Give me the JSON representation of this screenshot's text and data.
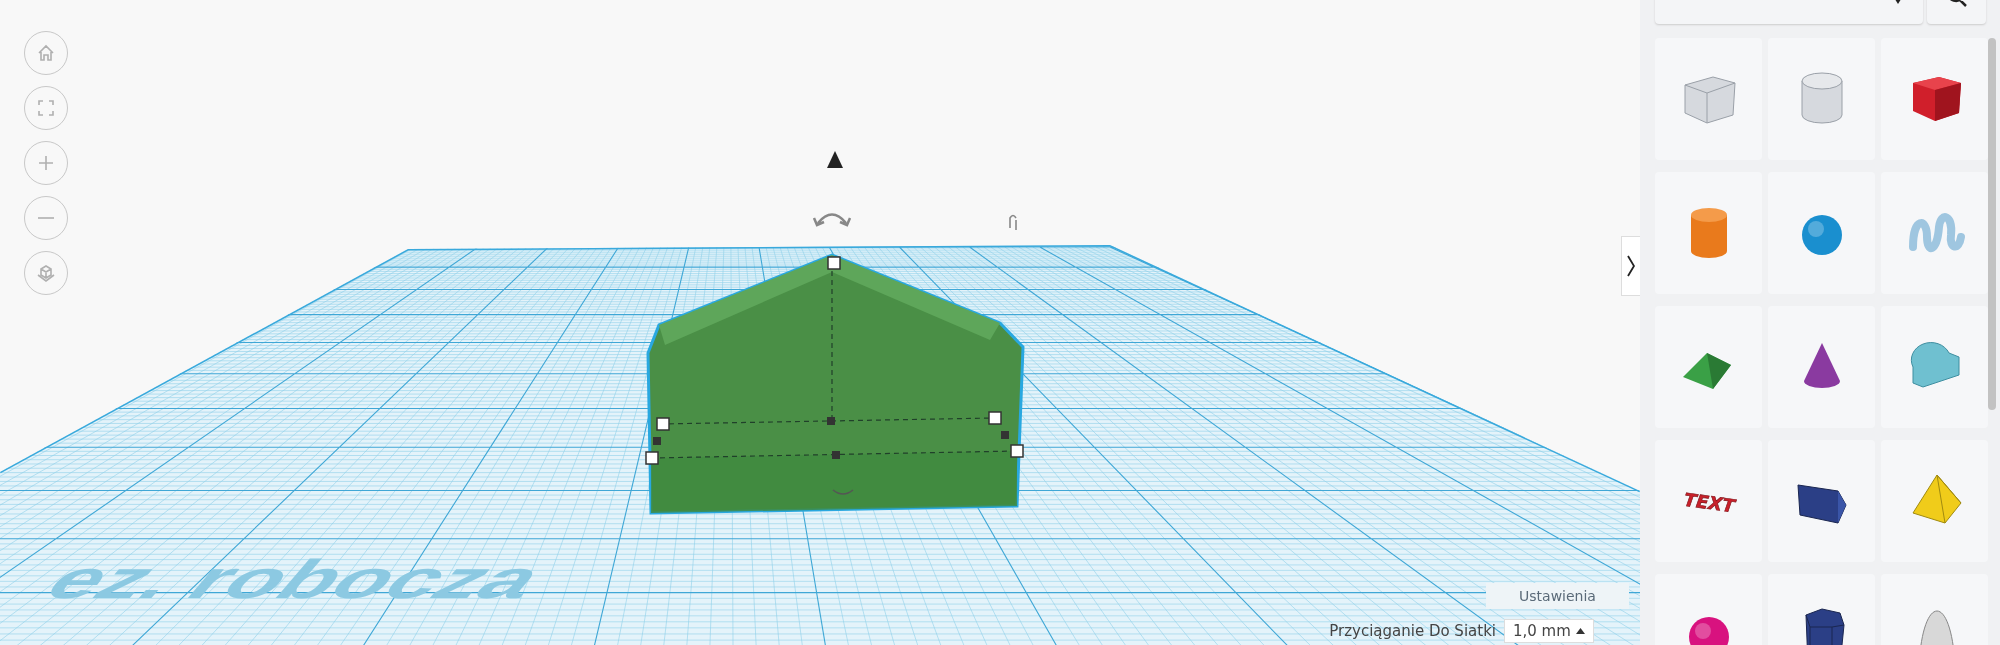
{
  "view_controls": [
    {
      "kind": "home"
    },
    {
      "kind": "fit"
    },
    {
      "kind": "zoom-in"
    },
    {
      "kind": "zoom-out"
    },
    {
      "kind": "view-cube"
    }
  ],
  "workplane": {
    "label": "ez. robocza"
  },
  "settings_button": {
    "label": "Ustawienia"
  },
  "snap_grid": {
    "label": "Przyciąganie Do Siatki",
    "value": "1,0 mm"
  },
  "shape_library": {
    "shapes": [
      {
        "kind": "box-hole"
      },
      {
        "kind": "cylinder-hole"
      },
      {
        "kind": "box",
        "color": "#d01f2b"
      },
      {
        "kind": "cylinder",
        "color": "#e97a1c"
      },
      {
        "kind": "sphere",
        "color": "#1a8fcf"
      },
      {
        "kind": "scribble",
        "color": "#9fc6e0"
      },
      {
        "kind": "roof",
        "color": "#3aa046"
      },
      {
        "kind": "cone",
        "color": "#8a3aa0"
      },
      {
        "kind": "round-roof",
        "color": "#6fc0d0"
      },
      {
        "kind": "text",
        "color": "#c8202a",
        "text": "TEXT"
      },
      {
        "kind": "wedge",
        "color": "#2b3f86"
      },
      {
        "kind": "pyramid",
        "color": "#f0cc1a"
      },
      {
        "kind": "sphere",
        "color": "#d8127f"
      },
      {
        "kind": "polygon",
        "color": "#2b3f86"
      },
      {
        "kind": "paraboloid",
        "color": "#d8d8d8"
      }
    ]
  }
}
